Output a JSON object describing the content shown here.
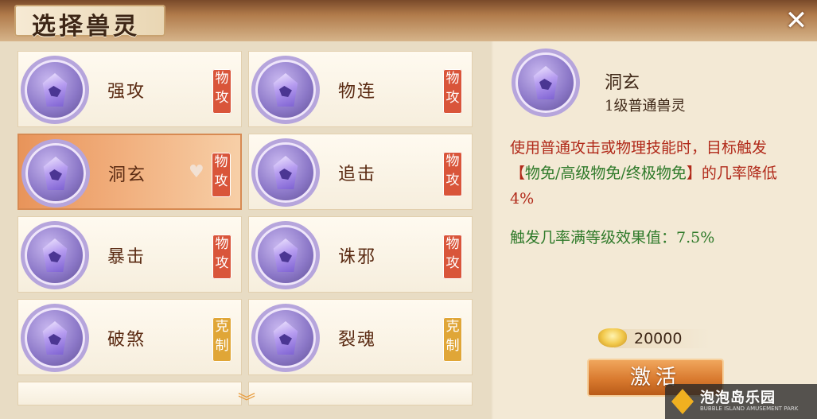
{
  "header": {
    "title": "选择兽灵",
    "close_symbol": "✕"
  },
  "cards": [
    {
      "name": "强攻",
      "badge": "物攻",
      "badge_type": "phys",
      "selected": false
    },
    {
      "name": "物连",
      "badge": "物攻",
      "badge_type": "phys",
      "selected": false
    },
    {
      "name": "洞玄",
      "badge": "物攻",
      "badge_type": "phys",
      "selected": true
    },
    {
      "name": "追击",
      "badge": "物攻",
      "badge_type": "phys",
      "selected": false
    },
    {
      "name": "暴击",
      "badge": "物攻",
      "badge_type": "phys",
      "selected": false
    },
    {
      "name": "诛邪",
      "badge": "物攻",
      "badge_type": "phys",
      "selected": false
    },
    {
      "name": "破煞",
      "badge": "克制",
      "badge_type": "counter",
      "selected": false
    },
    {
      "name": "裂魂",
      "badge": "克制",
      "badge_type": "counter",
      "selected": false
    }
  ],
  "detail": {
    "name": "洞玄",
    "level": "1级普通兽灵",
    "desc_part1": "使用普通攻击或物理技能时，目标触发【",
    "desc_green": "物免/高级物免/终极物免",
    "desc_part2": "】的几率降低4%",
    "max_effect": "触发几率满等级效果值：7.5%"
  },
  "cost": {
    "amount": "20000"
  },
  "activate_label": "激活",
  "watermark": {
    "title": "泡泡岛乐园",
    "subtitle": "BUBBLE ISLAND AMUSEMENT PARK"
  },
  "colors": {
    "phys_badge": "#d9553a",
    "counter_badge": "#e0a637",
    "desc_red": "#b12a1a",
    "desc_green": "#2f7a2a"
  }
}
